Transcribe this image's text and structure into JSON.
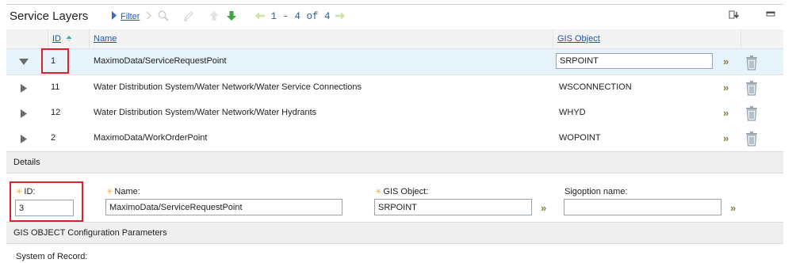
{
  "header": {
    "title": "Service Layers"
  },
  "toolbar": {
    "filter_label": "Filter",
    "pager": "1 - 4 of 4"
  },
  "table": {
    "columns": {
      "id": "ID",
      "name": "Name",
      "gis_object": "GIS Object"
    },
    "rows": [
      {
        "id": "1",
        "name": "MaximoData/ServiceRequestPoint",
        "gis_object": "SRPOINT",
        "expanded": true
      },
      {
        "id": "11",
        "name": "Water Distribution System/Water Network/Water Service Connections",
        "gis_object": "WSCONNECTION",
        "expanded": false
      },
      {
        "id": "12",
        "name": "Water Distribution System/Water Network/Water Hydrants",
        "gis_object": "WHYD",
        "expanded": false
      },
      {
        "id": "2",
        "name": "MaximoData/WorkOrderPoint",
        "gis_object": "WOPOINT",
        "expanded": false
      }
    ]
  },
  "details": {
    "section_title": "Details",
    "id_label": "ID:",
    "id_value": "3",
    "name_label": "Name:",
    "name_value": "MaximoData/ServiceRequestPoint",
    "gis_object_label": "GIS Object:",
    "gis_object_value": "SRPOINT",
    "sigoption_label": "Sigoption name:",
    "sigoption_value": ""
  },
  "config": {
    "section_title": "GIS OBJECT Configuration Parameters",
    "system_of_record_label": "System of Record:"
  },
  "colors": {
    "link": "#2156a5",
    "selected_row": "#e6f3fb",
    "highlight_box": "#d8232a",
    "required_star": "#e8b341"
  }
}
